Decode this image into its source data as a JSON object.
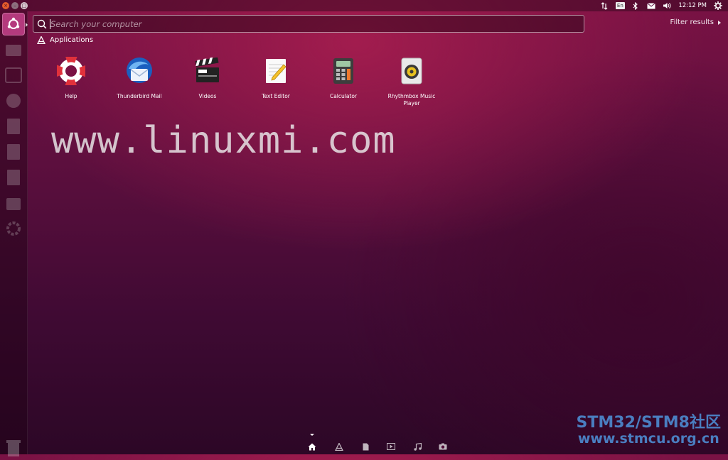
{
  "window_controls": {
    "close": "×",
    "minimize": "–",
    "maximize": "□"
  },
  "indicators": {
    "language": "En",
    "time": "12:12 PM"
  },
  "search": {
    "placeholder": "Search your computer",
    "value": ""
  },
  "filter": {
    "label": "Filter results"
  },
  "section": {
    "title": "Applications"
  },
  "apps": [
    {
      "label": "Help",
      "icon": "help-lifebuoy-icon"
    },
    {
      "label": "Thunderbird Mail",
      "icon": "thunderbird-icon"
    },
    {
      "label": "Videos",
      "icon": "clapperboard-icon"
    },
    {
      "label": "Text Editor",
      "icon": "text-editor-icon"
    },
    {
      "label": "Calculator",
      "icon": "calculator-icon"
    },
    {
      "label": "Rhythmbox Music Player",
      "icon": "rhythmbox-icon"
    }
  ],
  "watermark": {
    "text": "www.linuxmi.com"
  },
  "site_mark": {
    "line1": "STM32/STM8社区",
    "line2": "www.stmcu.org.cn"
  },
  "colors": {
    "accent": "#b43a7d",
    "background_top": "#7a1244",
    "background_bottom": "#2c0726",
    "site_mark": "#4a7ec0"
  }
}
